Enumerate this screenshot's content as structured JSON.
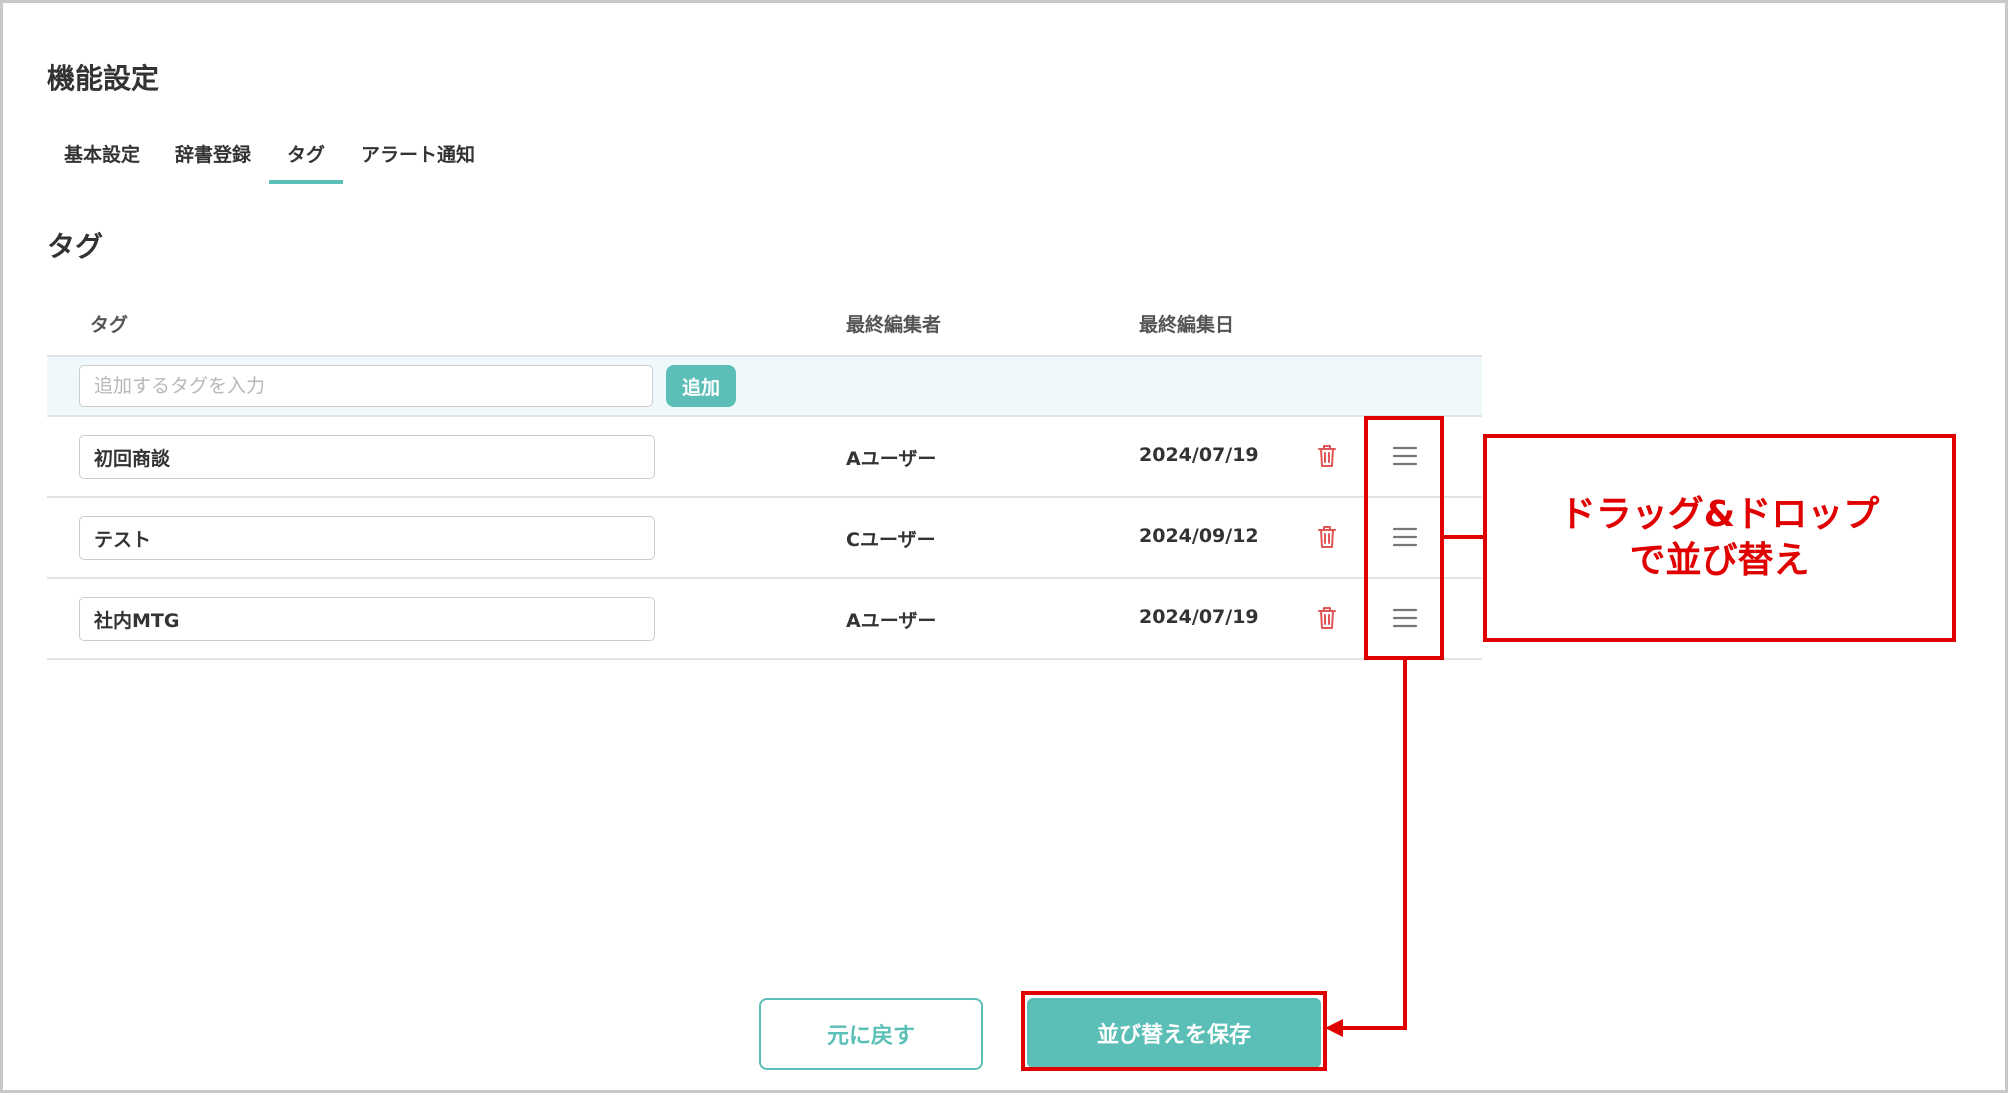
{
  "page": {
    "title": "機能設定",
    "tabs": [
      {
        "label": "基本設定",
        "active": false
      },
      {
        "label": "辞書登録",
        "active": false
      },
      {
        "label": "タグ",
        "active": true
      },
      {
        "label": "アラート通知",
        "active": false
      }
    ],
    "section_title": "タグ"
  },
  "table": {
    "headers": {
      "tag": "タグ",
      "editor": "最終編集者",
      "date": "最終編集日"
    },
    "add_row": {
      "placeholder": "追加するタグを入力",
      "value": "",
      "button_label": "追加"
    },
    "rows": [
      {
        "tag": "初回商談",
        "editor": "Aユーザー",
        "date": "2024/07/19"
      },
      {
        "tag": "テスト",
        "editor": "Cユーザー",
        "date": "2024/09/12"
      },
      {
        "tag": "社内MTG",
        "editor": "Aユーザー",
        "date": "2024/07/19"
      }
    ],
    "icons": {
      "delete": "trash-icon",
      "drag": "drag-handle-icon"
    }
  },
  "footer": {
    "revert_label": "元に戻す",
    "save_label": "並び替えを保存"
  },
  "annotation": {
    "callout_line1": "ドラッグ&ドロップ",
    "callout_line2": "で並び替え",
    "color": "#e00000"
  },
  "colors": {
    "accent": "#5bbfb7",
    "delete_icon": "#e05555",
    "annotation": "#e00000"
  }
}
